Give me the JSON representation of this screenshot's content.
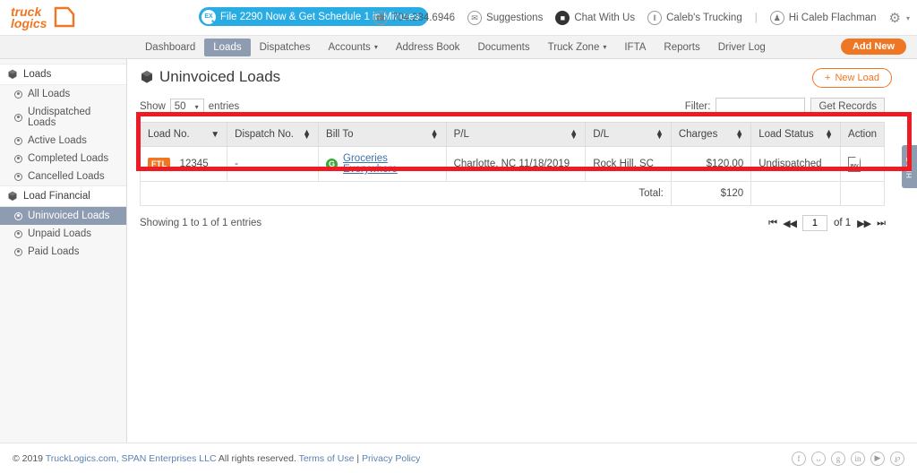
{
  "brand": {
    "logo_line1": "truck",
    "logo_line2": "logics",
    "accent": "#ef7622",
    "blue": "#29ace3",
    "nav_active": "#8e9cb2"
  },
  "header": {
    "promo": {
      "badge": "EX",
      "text": "File 2290 Now & Get Schedule 1 in Minutes"
    },
    "items": [
      {
        "icon": "phone-icon",
        "glyph": "☎",
        "label": "704.234.6946"
      },
      {
        "icon": "envelope-icon",
        "glyph": "✉",
        "label": "Suggestions"
      },
      {
        "icon": "chat-icon",
        "glyph": "■",
        "label": "Chat With Us"
      },
      {
        "icon": "company-icon",
        "glyph": "‖",
        "label": "Caleb's Trucking"
      },
      {
        "icon": "user-icon",
        "glyph": "♟",
        "label": "Hi Caleb Flachman"
      }
    ],
    "separator": "|",
    "gear_glyph": "⚙",
    "gear_caret": "▾"
  },
  "nav": {
    "items": [
      {
        "label": "Dashboard",
        "caret": "",
        "active": false
      },
      {
        "label": "Loads",
        "caret": "",
        "active": true
      },
      {
        "label": "Dispatches",
        "caret": "",
        "active": false
      },
      {
        "label": "Accounts",
        "caret": "▾",
        "active": false
      },
      {
        "label": "Address Book",
        "caret": "",
        "active": false
      },
      {
        "label": "Documents",
        "caret": "",
        "active": false
      },
      {
        "label": "Truck Zone",
        "caret": "▾",
        "active": false
      },
      {
        "label": "IFTA",
        "caret": "",
        "active": false
      },
      {
        "label": "Reports",
        "caret": "",
        "active": false
      },
      {
        "label": "Driver Log",
        "caret": "",
        "active": false
      }
    ],
    "add_new": "Add New"
  },
  "sidebar": {
    "groups": [
      {
        "label": "Loads",
        "icon": "cube-icon",
        "items": [
          {
            "label": "All Loads",
            "active": false
          },
          {
            "label": "Undispatched Loads",
            "active": false
          },
          {
            "label": "Active Loads",
            "active": false
          },
          {
            "label": "Completed Loads",
            "active": false
          },
          {
            "label": "Cancelled Loads",
            "active": false
          }
        ]
      },
      {
        "label": "Load Financial",
        "icon": "cube-icon",
        "items": [
          {
            "label": "Uninvoiced Loads",
            "active": true
          },
          {
            "label": "Unpaid Loads",
            "active": false
          },
          {
            "label": "Paid Loads",
            "active": false
          }
        ]
      }
    ]
  },
  "main": {
    "title": "Uninvoiced Loads",
    "new_load_label": "New Load",
    "new_load_plus": "+",
    "show_label": "Show",
    "entries_label": "entries",
    "page_size": "50",
    "page_size_caret": "▾",
    "filter_label": "Filter:",
    "filter_value": "",
    "filter_placeholder": "",
    "get_records_label": "Get Records",
    "help_tab": "HELP"
  },
  "table": {
    "columns": [
      {
        "label": "Load No.",
        "sort": "down",
        "align": "left"
      },
      {
        "label": "Dispatch No.",
        "sort": "both",
        "align": "left"
      },
      {
        "label": "Bill To",
        "sort": "both",
        "align": "left"
      },
      {
        "label": "P/L",
        "sort": "both",
        "align": "left"
      },
      {
        "label": "D/L",
        "sort": "both",
        "align": "left"
      },
      {
        "label": "Charges",
        "sort": "both",
        "align": "right"
      },
      {
        "label": "Load Status",
        "sort": "both",
        "align": "left"
      },
      {
        "label": "Action",
        "sort": "none",
        "align": "left"
      }
    ],
    "rows": [
      {
        "badge": "FTL",
        "load_no": "12345",
        "dispatch_no": "-",
        "bill_to": "Groceries Everywhere",
        "bill_to_avatar": "G",
        "pl": "Charlotte, NC 11/18/2019",
        "dl": "Rock Hill, SC",
        "charges": "$120.00",
        "status": "Undispatched",
        "action_icon": "invoice-icon",
        "action_icon_text": "INV"
      }
    ],
    "total_label": "Total:",
    "total_value": "$120"
  },
  "pagination": {
    "showing": "Showing 1 to 1 of 1 entries",
    "first": "⏮",
    "prev": "◀◀",
    "page": "1",
    "of": "of 1",
    "next": "▶▶",
    "last": "⏭"
  },
  "footer": {
    "copyright_pre": "© 2019 ",
    "site": "TruckLogics.com,",
    "company": " SPAN Enterprises LLC",
    "rights": " All rights reserved. ",
    "terms": "Terms of Use",
    "pipe": " | ",
    "privacy": "Privacy Policy",
    "social": [
      {
        "name": "facebook-icon",
        "glyph": "f"
      },
      {
        "name": "twitter-icon",
        "glyph": "ᴗ"
      },
      {
        "name": "googleplus-icon",
        "glyph": "g"
      },
      {
        "name": "linkedin-icon",
        "glyph": "in"
      },
      {
        "name": "youtube-icon",
        "glyph": "▶"
      },
      {
        "name": "pinterest-icon",
        "glyph": "℘"
      }
    ]
  }
}
